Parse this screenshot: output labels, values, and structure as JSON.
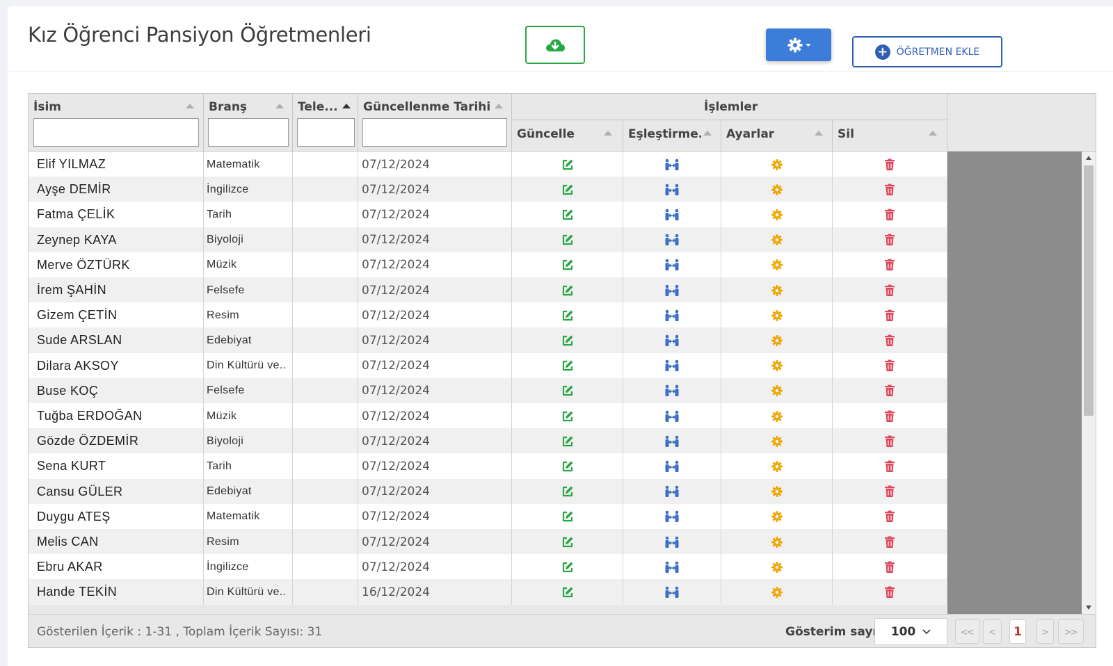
{
  "header": {
    "title": "Kız Öğrenci Pansiyon Öğretmenleri",
    "add_button_label": "ÖĞRETMEN EKLE"
  },
  "colors": {
    "update": "#28a745",
    "match": "#3b6fc4",
    "settings": "#f0a500",
    "delete": "#e0475b",
    "primary": "#3b7dd8"
  },
  "grid": {
    "columns": {
      "isim": "İsim",
      "brans": "Branş",
      "telefon": "Tele...",
      "tarih": "Güncellenme Tarihi",
      "islemler": "İşlemler",
      "guncelle": "Güncelle",
      "eslestirme": "Eşleştirme...",
      "ayarlar": "Ayarlar",
      "sil": "Sil"
    },
    "rows": [
      {
        "isim": "Elif YILMAZ",
        "brans": "Matematik",
        "telefon": "",
        "tarih": "07/12/2024"
      },
      {
        "isim": "Ayşe DEMİR",
        "brans": "İngilizce",
        "telefon": "",
        "tarih": "07/12/2024"
      },
      {
        "isim": "Fatma ÇELİK",
        "brans": "Tarih",
        "telefon": "",
        "tarih": "07/12/2024"
      },
      {
        "isim": "Zeynep KAYA",
        "brans": "Biyoloji",
        "telefon": "",
        "tarih": "07/12/2024"
      },
      {
        "isim": "Merve ÖZTÜRK",
        "brans": "Müzik",
        "telefon": "",
        "tarih": "07/12/2024"
      },
      {
        "isim": "İrem ŞAHİN",
        "brans": "Felsefe",
        "telefon": "",
        "tarih": "07/12/2024"
      },
      {
        "isim": "Gizem ÇETİN",
        "brans": "Resim",
        "telefon": "",
        "tarih": "07/12/2024"
      },
      {
        "isim": "Sude ARSLAN",
        "brans": "Edebiyat",
        "telefon": "",
        "tarih": "07/12/2024"
      },
      {
        "isim": "Dilara AKSOY",
        "brans": "Din Kültürü ve..",
        "telefon": "",
        "tarih": "07/12/2024"
      },
      {
        "isim": "Buse KOÇ",
        "brans": "Felsefe",
        "telefon": "",
        "tarih": "07/12/2024"
      },
      {
        "isim": "Tuğba ERDOĞAN",
        "brans": "Müzik",
        "telefon": "",
        "tarih": "07/12/2024"
      },
      {
        "isim": "Gözde ÖZDEMİR",
        "brans": "Biyoloji",
        "telefon": "",
        "tarih": "07/12/2024"
      },
      {
        "isim": "Sena KURT",
        "brans": "Tarih",
        "telefon": "",
        "tarih": "07/12/2024"
      },
      {
        "isim": "Cansu GÜLER",
        "brans": "Edebiyat",
        "telefon": "",
        "tarih": "07/12/2024"
      },
      {
        "isim": "Duygu ATEŞ",
        "brans": "Matematik",
        "telefon": "",
        "tarih": "07/12/2024"
      },
      {
        "isim": "Melis CAN",
        "brans": "Resim",
        "telefon": "",
        "tarih": "07/12/2024"
      },
      {
        "isim": "Ebru AKAR",
        "brans": "İngilizce",
        "telefon": "",
        "tarih": "07/12/2024"
      },
      {
        "isim": "Hande TEKİN",
        "brans": "Din Kültürü ve..",
        "telefon": "",
        "tarih": "16/12/2024"
      }
    ]
  },
  "footer": {
    "info": "Gösterilen İçerik : 1-31 , Toplam İçerik Sayısı: 31",
    "page_size_label": "Gösterim sayısı",
    "page_size_value": "100",
    "first": "<<",
    "prev": "<",
    "current_page": "1",
    "next": ">",
    "last": ">>"
  }
}
